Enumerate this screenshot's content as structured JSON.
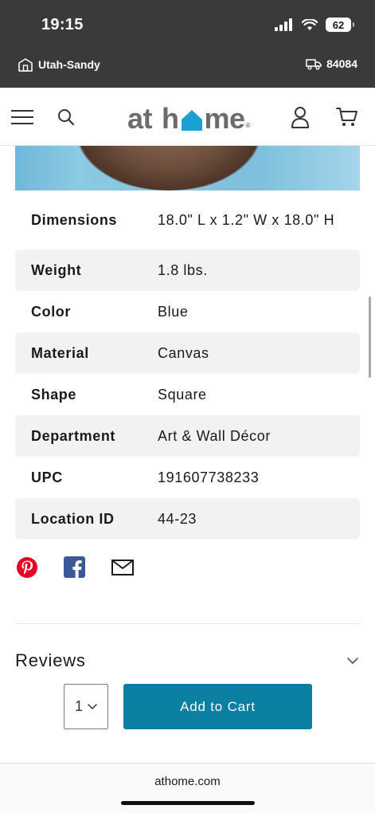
{
  "status_bar": {
    "time": "19:15",
    "battery": "62"
  },
  "store_bar": {
    "store": "Utah-Sandy",
    "zip": "84084"
  },
  "header": {
    "logo": {
      "part1": "at",
      "part2": "h",
      "part3": "me"
    },
    "menu_icon": "hamburger-menu-icon",
    "search_icon": "search-icon",
    "account_icon": "user-icon",
    "cart_icon": "cart-icon"
  },
  "specs": [
    {
      "label": "Dimensions",
      "value": "18.0\" L x 1.2\" W x 18.0\" H"
    },
    {
      "label": "Weight",
      "value": "1.8 lbs."
    },
    {
      "label": "Color",
      "value": "Blue"
    },
    {
      "label": "Material",
      "value": "Canvas"
    },
    {
      "label": "Shape",
      "value": "Square"
    },
    {
      "label": "Department",
      "value": "Art & Wall Décor"
    },
    {
      "label": "UPC",
      "value": "191607738233"
    },
    {
      "label": "Location ID",
      "value": "44-23"
    }
  ],
  "share": {
    "icons": [
      "pinterest-icon",
      "facebook-icon",
      "email-icon"
    ]
  },
  "reviews": {
    "title": "Reviews"
  },
  "cart": {
    "quantity": "1",
    "add_label": "Add to Cart"
  },
  "browser": {
    "url": "athome.com"
  },
  "colors": {
    "accent": "#0b7fa1",
    "logo_house": "#1aa0d3",
    "pinterest": "#e60023",
    "facebook": "#3b5998"
  }
}
